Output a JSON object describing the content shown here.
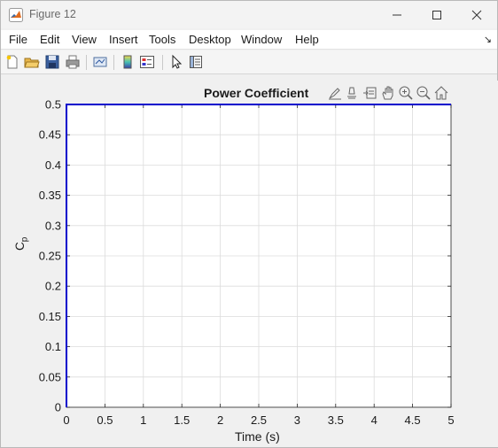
{
  "window": {
    "title": "Figure 12"
  },
  "menu": {
    "items": [
      "File",
      "Edit",
      "View",
      "Insert",
      "Tools",
      "Desktop",
      "Window",
      "Help"
    ],
    "overflow_glyph": "↘"
  },
  "toolbar": {
    "buttons": [
      "new-figure-icon",
      "open-file-icon",
      "save-icon",
      "print-icon",
      "link-plot-icon",
      "colorbar-icon",
      "legend-icon",
      "edit-plot-pointer-icon",
      "property-inspector-icon"
    ]
  },
  "axes_toolbar": {
    "buttons": [
      "brush-icon",
      "data-tips-icon",
      "export-icon",
      "pan-icon",
      "zoom-in-icon",
      "zoom-out-icon",
      "home-icon"
    ]
  },
  "chart_data": {
    "type": "line",
    "title": "Power Coefficient",
    "xlabel": "Time (s)",
    "ylabel": "C",
    "ylabel_sub": "p",
    "xlim": [
      0,
      5
    ],
    "ylim": [
      0,
      0.5
    ],
    "x_ticks": [
      "0",
      "0.5",
      "1",
      "1.5",
      "2",
      "2.5",
      "3",
      "3.5",
      "4",
      "4.5",
      "5"
    ],
    "y_ticks": [
      "0",
      "0.05",
      "0.1",
      "0.15",
      "0.2",
      "0.25",
      "0.3",
      "0.35",
      "0.4",
      "0.45",
      "0.5"
    ],
    "grid": true,
    "series": [
      {
        "color": "#0000cc",
        "x": [
          0,
          0,
          5
        ],
        "y": [
          0,
          0.5,
          0.5
        ]
      }
    ]
  }
}
